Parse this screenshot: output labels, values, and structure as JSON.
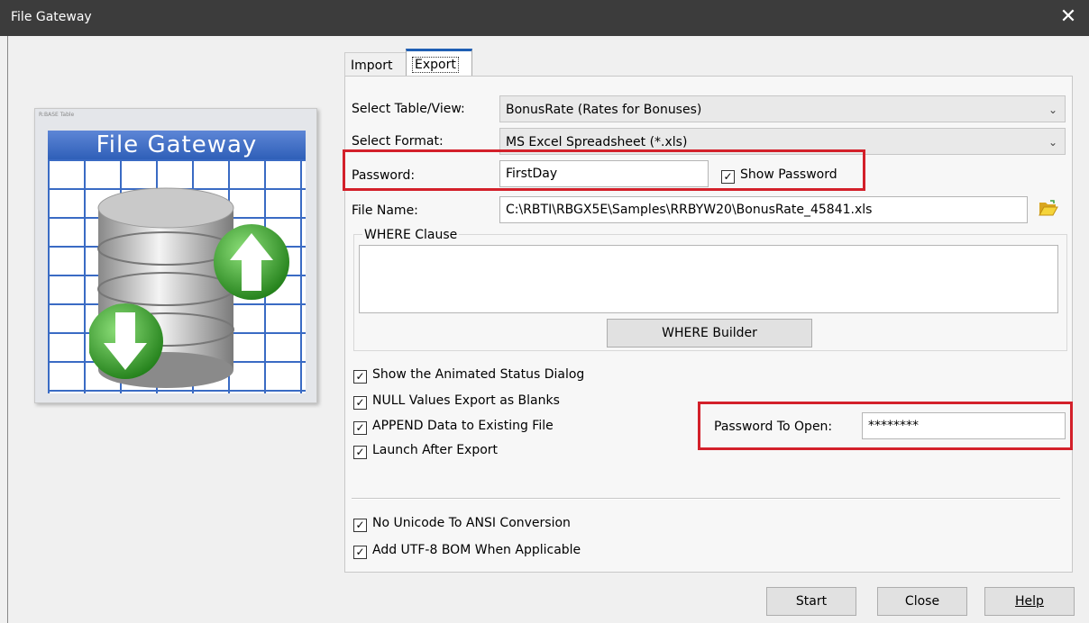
{
  "window": {
    "title": "File Gateway",
    "close_glyph": "✕"
  },
  "logo": {
    "small_text": "R:BASE Table",
    "banner": "File Gateway"
  },
  "tabs": [
    {
      "label": "Import"
    },
    {
      "label": "Export"
    }
  ],
  "form": {
    "table_label": "Select Table/View:",
    "table_value": "BonusRate  (Rates for Bonuses)",
    "format_label": "Select Format:",
    "format_value": "MS Excel Spreadsheet (*.xls)",
    "password_label": "Password:",
    "password_value": "FirstDay",
    "show_password_label": "Show Password",
    "filename_label": "File Name:",
    "filename_value": "C:\\RBTI\\RBGX5E\\Samples\\RRBYW20\\BonusRate_45841.xls",
    "where_title": "WHERE Clause",
    "where_value": "",
    "where_builder": "WHERE Builder"
  },
  "options": [
    {
      "label": "Show the Animated Status Dialog",
      "checked": true
    },
    {
      "label": "NULL Values Export as Blanks",
      "checked": true
    },
    {
      "label": "APPEND Data to Existing File",
      "checked": true
    },
    {
      "label": "Launch After Export",
      "checked": true
    }
  ],
  "password_open": {
    "label": "Password To Open:",
    "value": "********"
  },
  "options2": [
    {
      "label": "No Unicode To ANSI Conversion",
      "checked": true
    },
    {
      "label": "Add UTF-8 BOM When Applicable",
      "checked": true
    }
  ],
  "buttons": {
    "start": "Start",
    "close": "Close",
    "help": "Help"
  },
  "colors": {
    "highlight": "#d3202a",
    "titlebar": "#3c3c3c",
    "tab_accent": "#1f5fb4"
  }
}
